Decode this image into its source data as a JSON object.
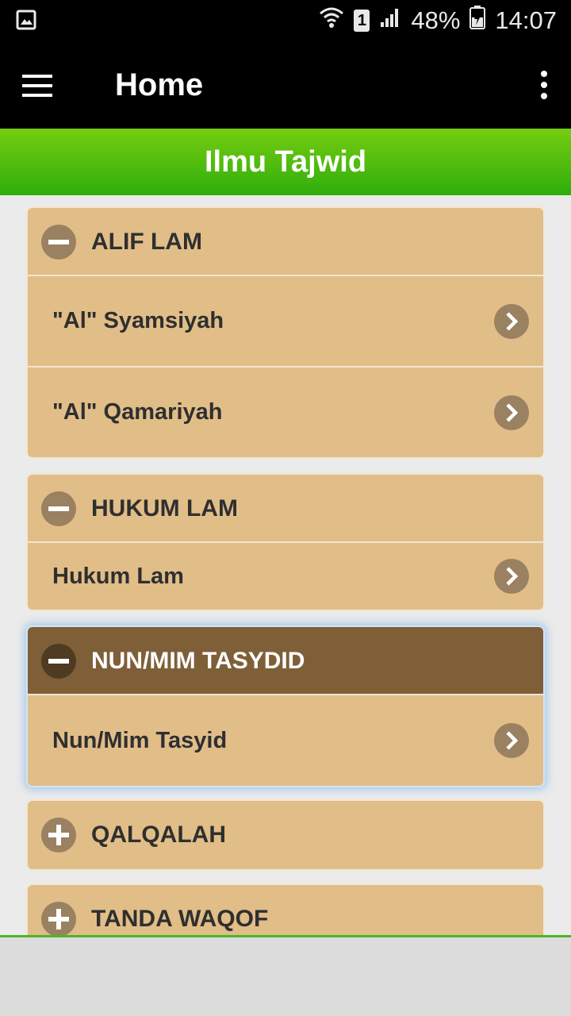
{
  "status_bar": {
    "sim_slot": "1",
    "battery": "48%",
    "time": "14:07",
    "icons": [
      "image-icon",
      "wifi-icon",
      "sim-icon",
      "signal-icon",
      "battery-icon"
    ]
  },
  "app_bar": {
    "title": "Home",
    "icons": [
      "menu-icon",
      "more-vert-icon"
    ]
  },
  "banner": {
    "title": "Ilmu Tajwid"
  },
  "groups": [
    {
      "title": "ALIF LAM",
      "state": "expanded",
      "items": [
        "\"Al\" Syamsiyah",
        "\"Al\" Qamariyah"
      ]
    },
    {
      "title": "HUKUM LAM",
      "state": "expanded",
      "items": [
        "Hukum Lam"
      ]
    },
    {
      "title": "NUN/MIM TASYDID",
      "state": "expanded-selected",
      "items": [
        "Nun/Mim Tasyid"
      ]
    },
    {
      "title": "QALQALAH",
      "state": "collapsed",
      "items": []
    },
    {
      "title": "TANDA WAQOF",
      "state": "collapsed",
      "items": []
    }
  ],
  "colors": {
    "app_bar": "#000000",
    "banner_top": "#76cc10",
    "banner_bottom": "#2fae0c",
    "card": "#e1bd88",
    "selected_header": "#7e5f38",
    "icon_circle": "#9a8161",
    "text": "#2f2f2f",
    "background": "#ebebeb"
  }
}
